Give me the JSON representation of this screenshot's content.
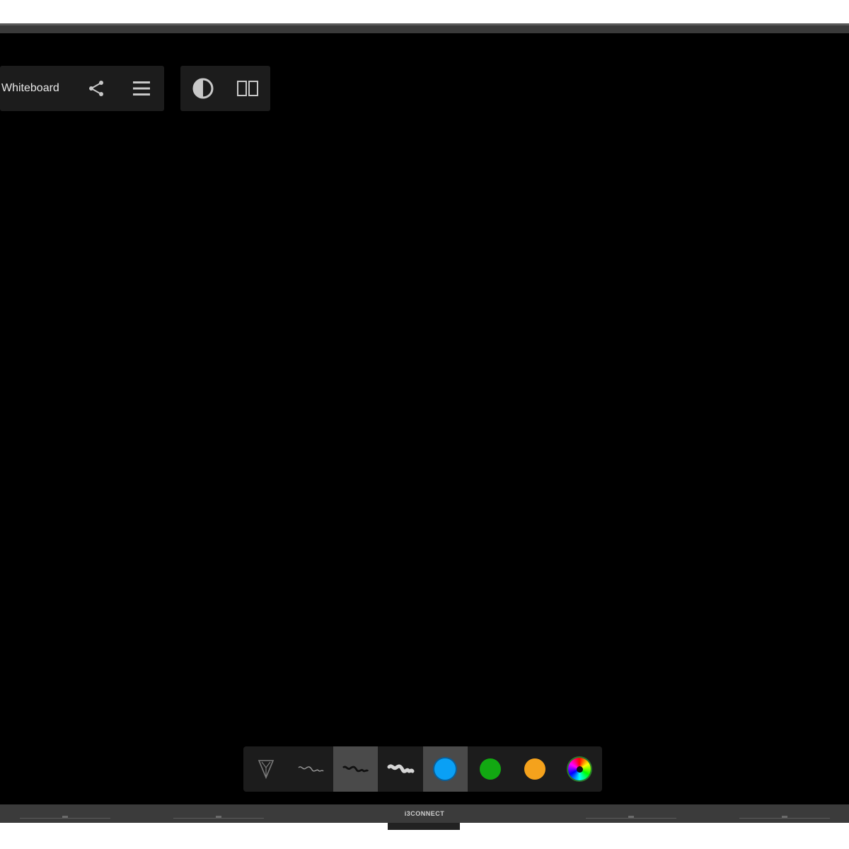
{
  "app": {
    "title": "w Whiteboard",
    "brand": "i3CONNECT"
  },
  "top_toolbar": {
    "items": [
      {
        "name": "share",
        "icon": "share-icon"
      },
      {
        "name": "menu",
        "icon": "hamburger-menu-icon"
      }
    ]
  },
  "view_toolbar": {
    "items": [
      {
        "name": "contrast",
        "icon": "contrast-icon"
      },
      {
        "name": "split-view",
        "icon": "split-view-icon"
      }
    ]
  },
  "draw_toolbar": {
    "tools": [
      {
        "name": "pen-tip",
        "icon": "pen-tip-icon",
        "selected": false
      },
      {
        "name": "stroke-thin",
        "icon": "thin-stroke-icon",
        "selected": false
      },
      {
        "name": "stroke-medium",
        "icon": "medium-stroke-icon",
        "selected": true
      },
      {
        "name": "stroke-thick",
        "icon": "thick-stroke-icon",
        "selected": false
      }
    ],
    "colors": [
      {
        "name": "blue",
        "hex": "#0aa0f5",
        "selected": true
      },
      {
        "name": "green",
        "hex": "#12a812",
        "selected": false
      },
      {
        "name": "orange",
        "hex": "#f5a21c",
        "selected": false
      }
    ],
    "color_picker_icon": "color-wheel-icon"
  },
  "colors": {
    "canvas": "#000000",
    "toolbar": "#1c1c1c",
    "icon": "#c8c8c8",
    "bezel": "#3a3a3a"
  }
}
